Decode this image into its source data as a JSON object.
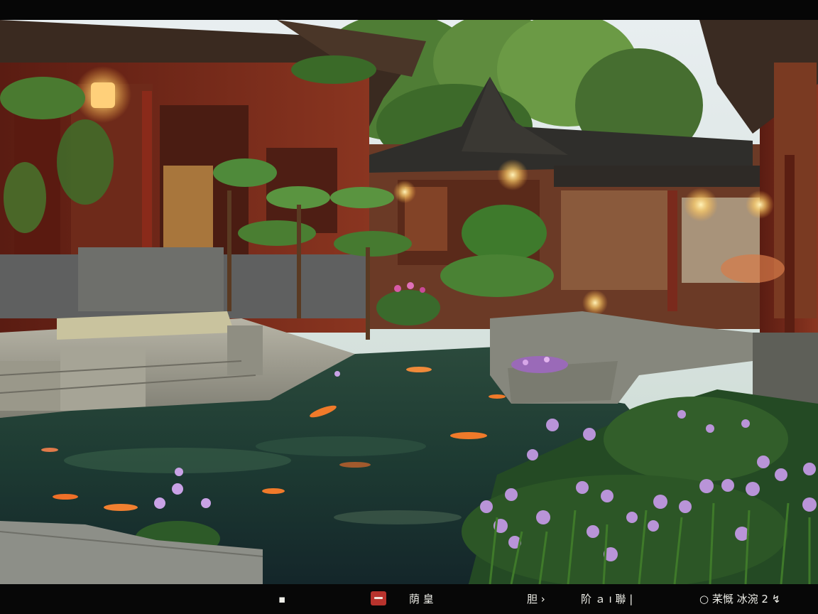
{
  "scene": {
    "name": "Chinese courtyard garden with koi pond",
    "colors": {
      "sky": "#dfe8ec",
      "pond": "#1f3a33",
      "timber_red": "#7a2a1c",
      "roof_tile": "#3c3a34",
      "lantern_glow": "#ffd98a",
      "iris_purple": "#b994d8",
      "koi_orange": "#f07a2a",
      "foliage": "#3f6a2a",
      "stone": "#8b8d86"
    }
  },
  "hud": {
    "item_1": "▪",
    "item_2": "荫 皇",
    "item_3": "胆 ›",
    "item_4": "阶 ａ ı 聯 |",
    "item_5": "○ 䒩慨 冰涴 2 ↯",
    "menu_icon": "red-badge-icon"
  }
}
